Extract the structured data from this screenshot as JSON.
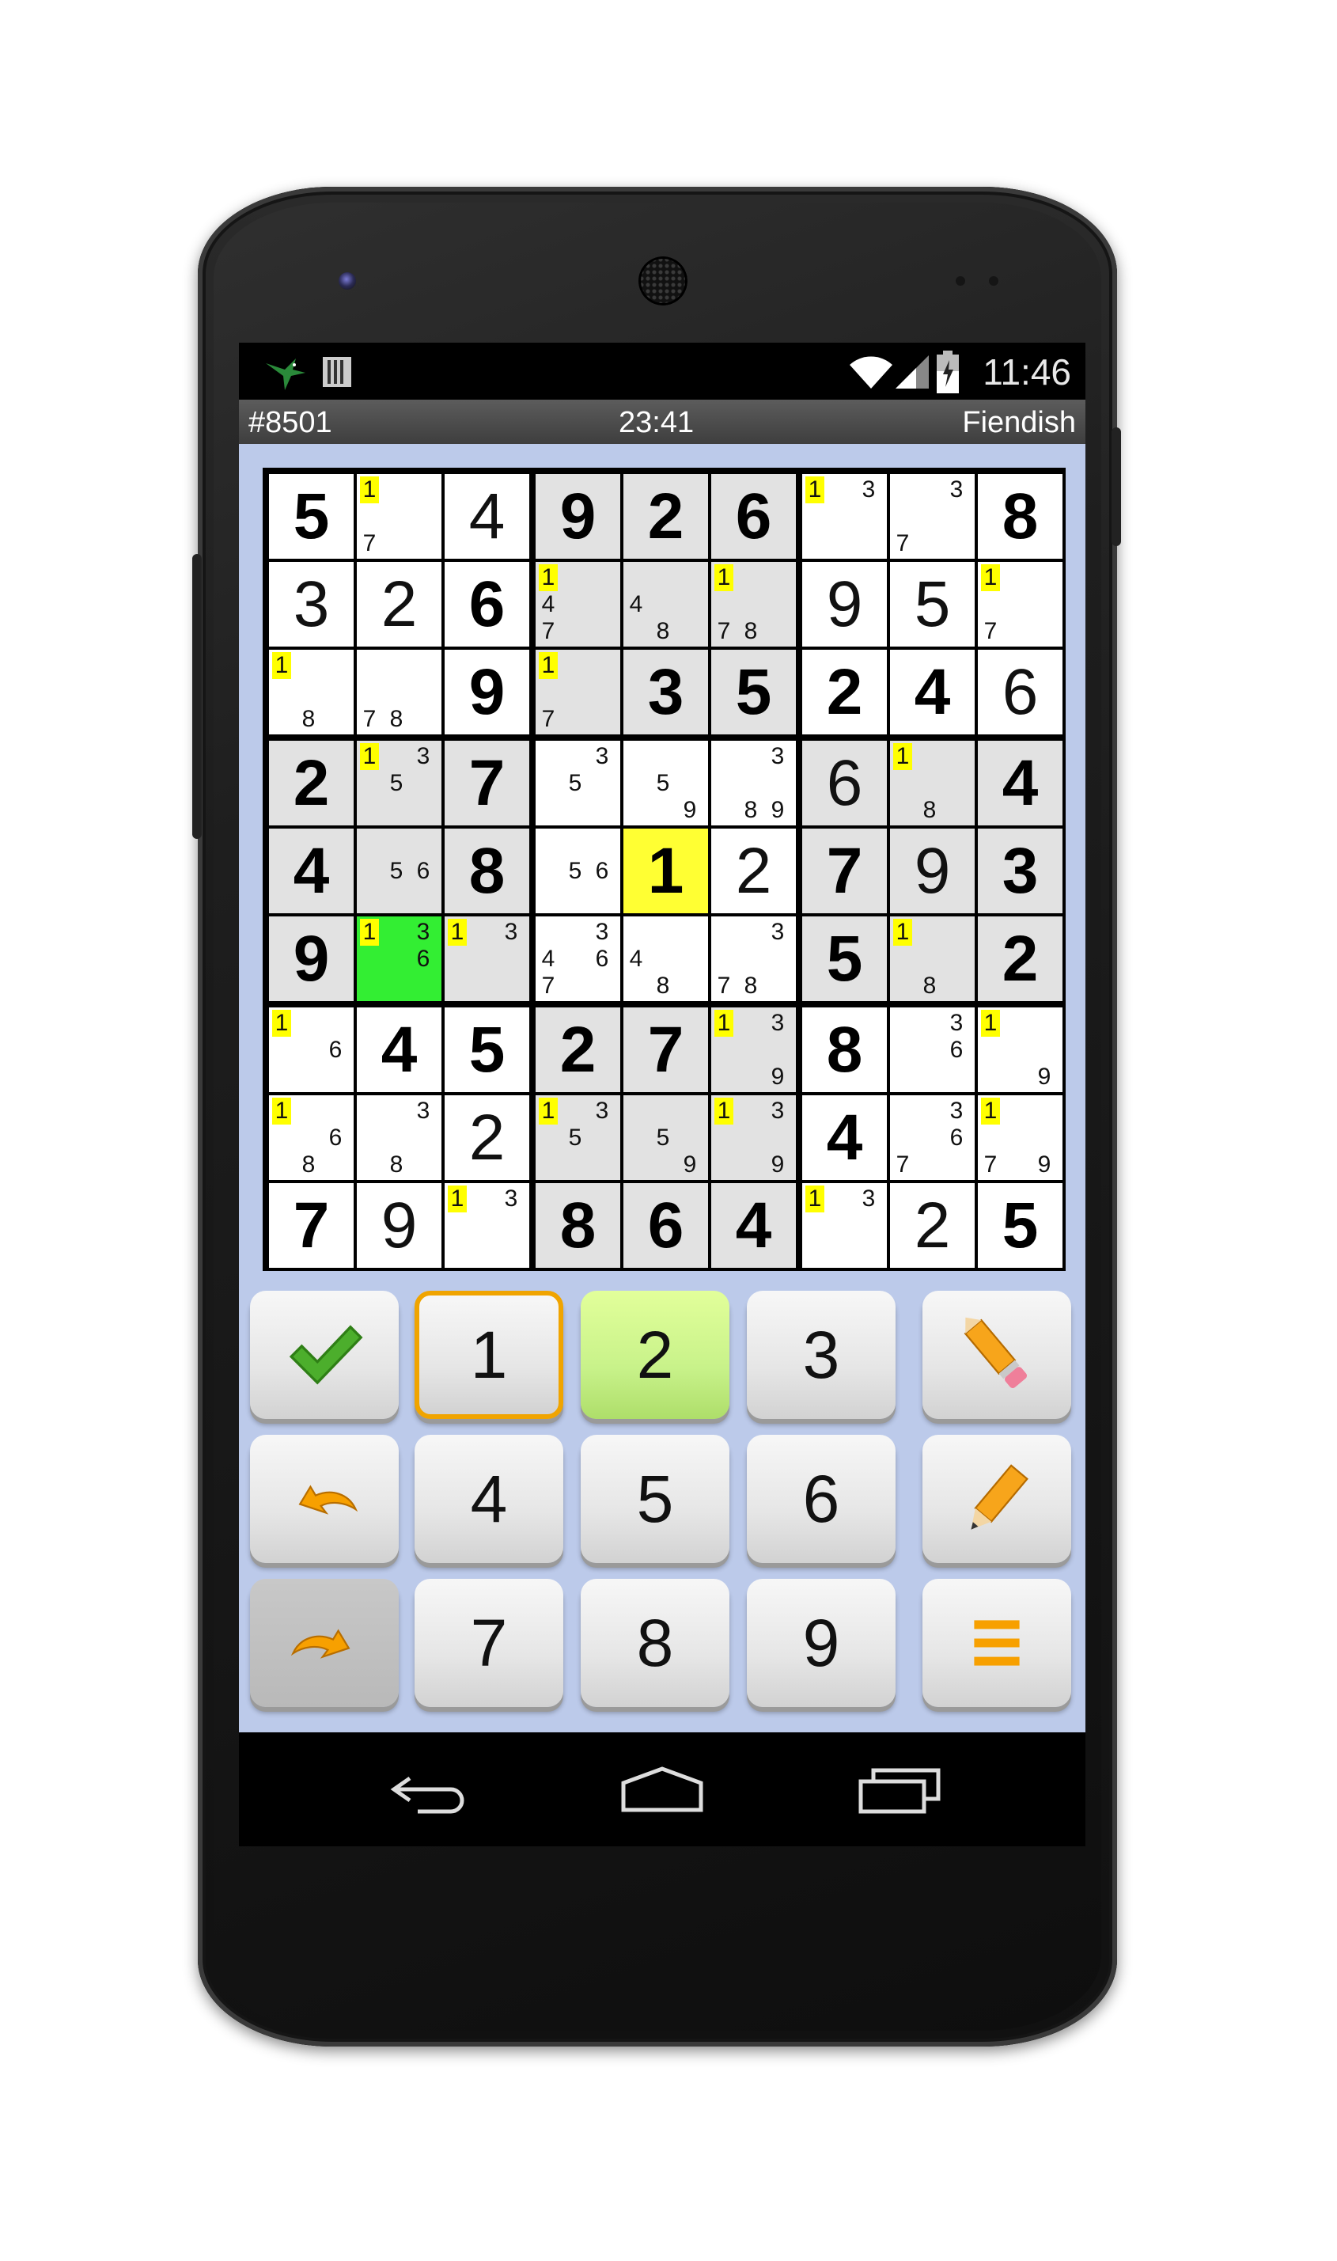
{
  "status_bar": {
    "time": "11:46"
  },
  "info_bar": {
    "puzzle_number": "#8501",
    "timer": "23:41",
    "difficulty": "Fiendish"
  },
  "board": {
    "cells": [
      [
        {
          "v": "5",
          "t": "g"
        },
        {
          "n": [
            1,
            7
          ],
          "h": [
            1
          ]
        },
        {
          "v": "4",
          "t": "u"
        },
        {
          "v": "9",
          "t": "g",
          "bg": "shade"
        },
        {
          "v": "2",
          "t": "g",
          "bg": "shade"
        },
        {
          "v": "6",
          "t": "g",
          "bg": "shade"
        },
        {
          "n": [
            1,
            3
          ],
          "h": [
            1
          ]
        },
        {
          "n": [
            3,
            7
          ]
        },
        {
          "v": "8",
          "t": "g"
        }
      ],
      [
        {
          "v": "3",
          "t": "u"
        },
        {
          "v": "2",
          "t": "u"
        },
        {
          "v": "6",
          "t": "g"
        },
        {
          "n": [
            1,
            4,
            7
          ],
          "h": [
            1
          ],
          "bg": "shade"
        },
        {
          "n": [
            4,
            8
          ],
          "bg": "shade"
        },
        {
          "n": [
            1,
            7,
            8
          ],
          "h": [
            1
          ],
          "bg": "shade"
        },
        {
          "v": "9",
          "t": "u"
        },
        {
          "v": "5",
          "t": "u"
        },
        {
          "n": [
            1,
            7
          ],
          "h": [
            1
          ]
        }
      ],
      [
        {
          "n": [
            1,
            8
          ],
          "h": [
            1
          ]
        },
        {
          "n": [
            7,
            8
          ]
        },
        {
          "v": "9",
          "t": "g"
        },
        {
          "n": [
            1,
            7
          ],
          "h": [
            1
          ],
          "bg": "shade"
        },
        {
          "v": "3",
          "t": "g",
          "bg": "shade"
        },
        {
          "v": "5",
          "t": "g",
          "bg": "shade"
        },
        {
          "v": "2",
          "t": "g"
        },
        {
          "v": "4",
          "t": "g"
        },
        {
          "v": "6",
          "t": "u"
        }
      ],
      [
        {
          "v": "2",
          "t": "g",
          "bg": "shade"
        },
        {
          "n": [
            1,
            3,
            5
          ],
          "h": [
            1
          ],
          "bg": "shade"
        },
        {
          "v": "7",
          "t": "g",
          "bg": "shade"
        },
        {
          "n": [
            3,
            5
          ]
        },
        {
          "n": [
            5,
            9
          ]
        },
        {
          "n": [
            3,
            8,
            9
          ]
        },
        {
          "v": "6",
          "t": "u",
          "bg": "shade"
        },
        {
          "n": [
            1,
            8
          ],
          "h": [
            1
          ],
          "bg": "shade"
        },
        {
          "v": "4",
          "t": "g",
          "bg": "shade"
        }
      ],
      [
        {
          "v": "4",
          "t": "g",
          "bg": "shade"
        },
        {
          "n": [
            5,
            6
          ],
          "bg": "shade"
        },
        {
          "v": "8",
          "t": "g",
          "bg": "shade"
        },
        {
          "n": [
            5,
            6
          ]
        },
        {
          "v": "1",
          "t": "g",
          "bg": "yellow"
        },
        {
          "v": "2",
          "t": "u"
        },
        {
          "v": "7",
          "t": "g",
          "bg": "shade"
        },
        {
          "v": "9",
          "t": "u",
          "bg": "shade"
        },
        {
          "v": "3",
          "t": "g",
          "bg": "shade"
        }
      ],
      [
        {
          "v": "9",
          "t": "g",
          "bg": "shade"
        },
        {
          "n": [
            1,
            3,
            6
          ],
          "h": [
            1
          ],
          "bg": "green"
        },
        {
          "n": [
            1,
            3
          ],
          "h": [
            1
          ],
          "bg": "shade"
        },
        {
          "n": [
            3,
            4,
            6,
            7
          ]
        },
        {
          "n": [
            4,
            8
          ]
        },
        {
          "n": [
            3,
            7,
            8
          ]
        },
        {
          "v": "5",
          "t": "g",
          "bg": "shade"
        },
        {
          "n": [
            1,
            8
          ],
          "h": [
            1
          ],
          "bg": "shade"
        },
        {
          "v": "2",
          "t": "g",
          "bg": "shade"
        }
      ],
      [
        {
          "n": [
            1,
            6
          ],
          "h": [
            1
          ]
        },
        {
          "v": "4",
          "t": "g"
        },
        {
          "v": "5",
          "t": "g"
        },
        {
          "v": "2",
          "t": "g",
          "bg": "shade"
        },
        {
          "v": "7",
          "t": "g",
          "bg": "shade"
        },
        {
          "n": [
            1,
            3,
            9
          ],
          "h": [
            1
          ],
          "bg": "shade"
        },
        {
          "v": "8",
          "t": "g"
        },
        {
          "n": [
            3,
            6
          ]
        },
        {
          "n": [
            1,
            9
          ],
          "h": [
            1
          ]
        }
      ],
      [
        {
          "n": [
            1,
            6,
            8
          ],
          "h": [
            1
          ]
        },
        {
          "n": [
            3,
            8
          ]
        },
        {
          "v": "2",
          "t": "u"
        },
        {
          "n": [
            1,
            3,
            5
          ],
          "h": [
            1
          ],
          "bg": "shade"
        },
        {
          "n": [
            5,
            9
          ],
          "bg": "shade"
        },
        {
          "n": [
            1,
            3,
            9
          ],
          "h": [
            1
          ],
          "bg": "shade"
        },
        {
          "v": "4",
          "t": "g"
        },
        {
          "n": [
            3,
            6,
            7
          ]
        },
        {
          "n": [
            1,
            7,
            9
          ],
          "h": [
            1
          ]
        }
      ],
      [
        {
          "v": "7",
          "t": "g"
        },
        {
          "v": "9",
          "t": "u"
        },
        {
          "n": [
            1,
            3
          ],
          "h": [
            1
          ]
        },
        {
          "v": "8",
          "t": "g",
          "bg": "shade"
        },
        {
          "v": "6",
          "t": "g",
          "bg": "shade"
        },
        {
          "v": "4",
          "t": "g",
          "bg": "shade"
        },
        {
          "n": [
            1,
            3
          ],
          "h": [
            1
          ]
        },
        {
          "v": "2",
          "t": "u"
        },
        {
          "v": "5",
          "t": "g"
        }
      ]
    ]
  },
  "keypad": {
    "digits": [
      "1",
      "2",
      "3",
      "4",
      "5",
      "6",
      "7",
      "8",
      "9"
    ],
    "selected_digit": "1",
    "highlighted_digit": "2",
    "icons": {
      "check": "check-icon",
      "eraser_pencil": "eraser-pencil-icon",
      "undo": "undo-icon",
      "pencil": "pencil-icon",
      "redo": "redo-icon",
      "menu": "menu-icon"
    }
  },
  "colors": {
    "app_background": "#bccaea",
    "shaded_cell": "#e2e2e2",
    "selected_cell": "#ffff33",
    "focus_cell": "#33ee33",
    "note_highlight": "#ffff00",
    "key_selected_border": "#f0a400",
    "key_highlight": "#c8f28a"
  }
}
